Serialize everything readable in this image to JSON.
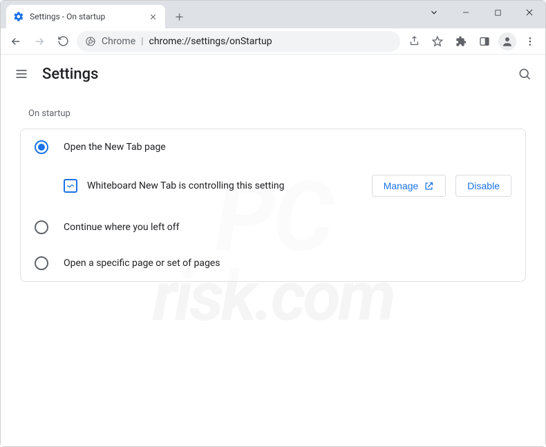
{
  "window": {
    "tab_title": "Settings - On startup"
  },
  "omnibox": {
    "prefix": "Chrome",
    "url": "chrome://settings/onStartup"
  },
  "header": {
    "title": "Settings"
  },
  "section": {
    "title": "On startup",
    "options": [
      {
        "label": "Open the New Tab page",
        "selected": true
      },
      {
        "label": "Continue where you left off",
        "selected": false
      },
      {
        "label": "Open a specific page or set of pages",
        "selected": false
      }
    ],
    "extension_notice": {
      "text": "Whiteboard New Tab is controlling this setting",
      "manage_label": "Manage",
      "disable_label": "Disable"
    }
  }
}
